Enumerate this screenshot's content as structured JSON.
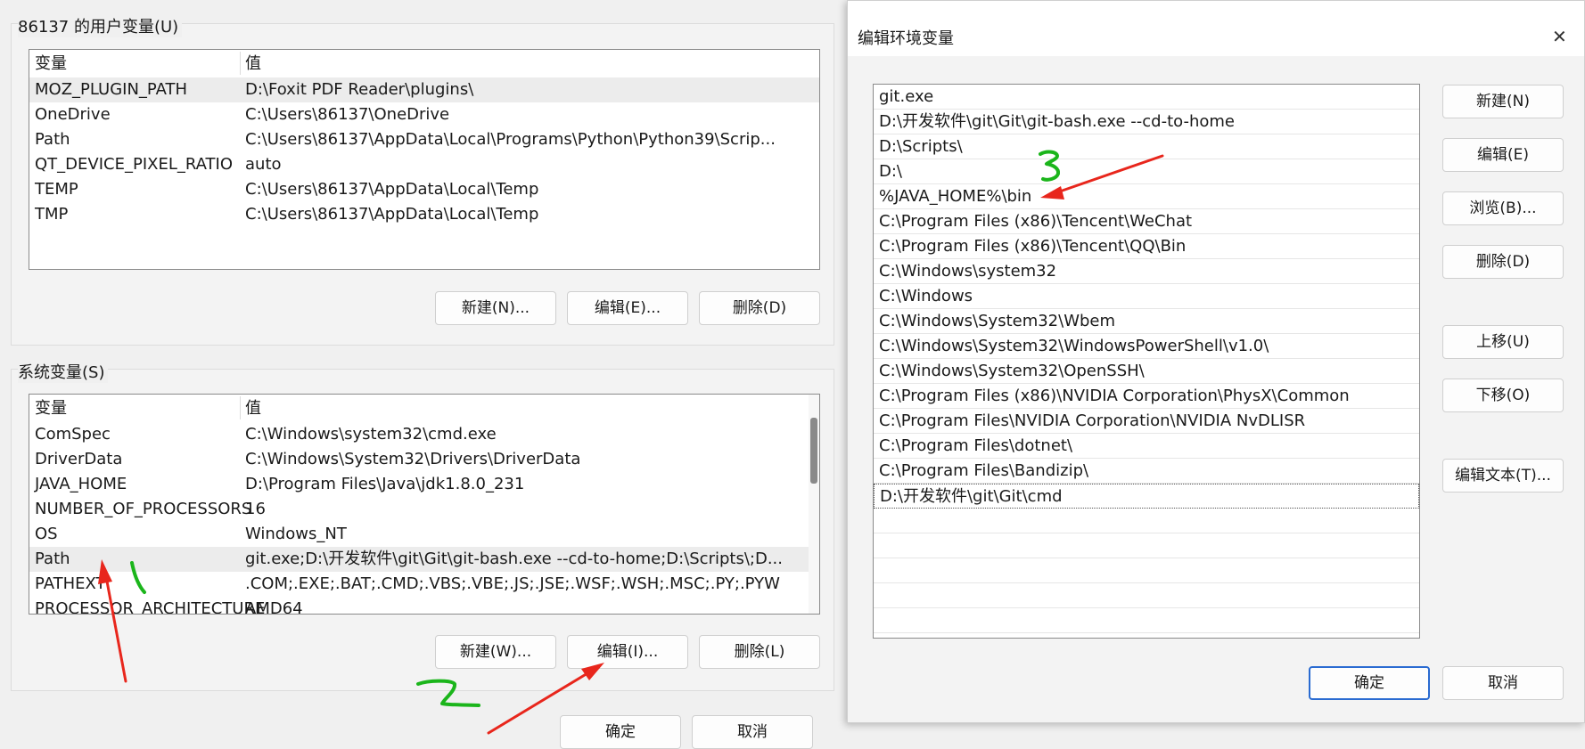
{
  "user_vars": {
    "title": "86137 的用户变量(U)",
    "col_name": "变量",
    "col_value": "值",
    "rows": [
      {
        "name": "MOZ_PLUGIN_PATH",
        "value": "D:\\Foxit PDF Reader\\plugins\\"
      },
      {
        "name": "OneDrive",
        "value": "C:\\Users\\86137\\OneDrive"
      },
      {
        "name": "Path",
        "value": "C:\\Users\\86137\\AppData\\Local\\Programs\\Python\\Python39\\Scrip..."
      },
      {
        "name": "QT_DEVICE_PIXEL_RATIO",
        "value": "auto"
      },
      {
        "name": "TEMP",
        "value": "C:\\Users\\86137\\AppData\\Local\\Temp"
      },
      {
        "name": "TMP",
        "value": "C:\\Users\\86137\\AppData\\Local\\Temp"
      }
    ],
    "buttons": {
      "new": "新建(N)...",
      "edit": "编辑(E)...",
      "delete": "删除(D)"
    }
  },
  "system_vars": {
    "title": "系统变量(S)",
    "col_name": "变量",
    "col_value": "值",
    "rows": [
      {
        "name": "ComSpec",
        "value": "C:\\Windows\\system32\\cmd.exe"
      },
      {
        "name": "DriverData",
        "value": "C:\\Windows\\System32\\Drivers\\DriverData"
      },
      {
        "name": "JAVA_HOME",
        "value": "D:\\Program Files\\Java\\jdk1.8.0_231"
      },
      {
        "name": "NUMBER_OF_PROCESSORS",
        "value": "16"
      },
      {
        "name": "OS",
        "value": "Windows_NT"
      },
      {
        "name": "Path",
        "value": "git.exe;D:\\开发软件\\git\\Git\\git-bash.exe --cd-to-home;D:\\Scripts\\;D..."
      },
      {
        "name": "PATHEXT",
        "value": ".COM;.EXE;.BAT;.CMD;.VBS;.VBE;.JS;.JSE;.WSF;.WSH;.MSC;.PY;.PYW"
      },
      {
        "name": "PROCESSOR_ARCHITECTURE",
        "value": "AMD64"
      }
    ],
    "buttons": {
      "new": "新建(W)...",
      "edit": "编辑(I)...",
      "delete": "删除(L)"
    }
  },
  "footer": {
    "ok": "确定",
    "cancel": "取消"
  },
  "edit_dialog": {
    "title": "编辑环境变量",
    "close_glyph": "✕",
    "paths": [
      "git.exe",
      "D:\\开发软件\\git\\Git\\git-bash.exe --cd-to-home",
      "D:\\Scripts\\",
      "D:\\",
      "%JAVA_HOME%\\bin",
      "C:\\Program Files (x86)\\Tencent\\WeChat",
      "C:\\Program Files (x86)\\Tencent\\QQ\\Bin",
      "C:\\Windows\\system32",
      "C:\\Windows",
      "C:\\Windows\\System32\\Wbem",
      "C:\\Windows\\System32\\WindowsPowerShell\\v1.0\\",
      "C:\\Windows\\System32\\OpenSSH\\",
      "C:\\Program Files (x86)\\NVIDIA Corporation\\PhysX\\Common",
      "C:\\Program Files\\NVIDIA Corporation\\NVIDIA NvDLISR",
      "C:\\Program Files\\dotnet\\",
      "C:\\Program Files\\Bandizip\\",
      "D:\\开发软件\\git\\Git\\cmd"
    ],
    "buttons": {
      "new": "新建(N)",
      "edit": "编辑(E)",
      "browse": "浏览(B)...",
      "delete": "删除(D)",
      "move_up": "上移(U)",
      "move_down": "下移(O)",
      "edit_text": "编辑文本(T)...",
      "ok": "确定",
      "cancel": "取消"
    }
  },
  "annotations": {
    "colors": {
      "arrow": "#e8261c",
      "handwriting": "#1bb51b"
    }
  }
}
